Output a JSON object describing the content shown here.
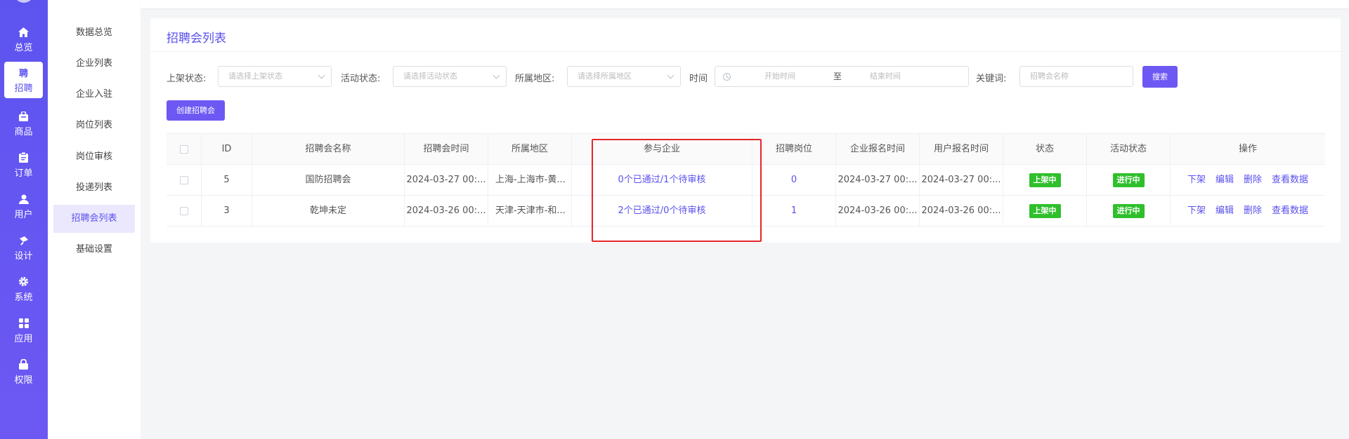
{
  "nav": {
    "items": [
      {
        "label": "总览",
        "icon": "home-icon"
      },
      {
        "label": "招聘",
        "icon": "recruit-icon",
        "badge": "聘",
        "active": true
      },
      {
        "label": "商品",
        "icon": "bag-icon"
      },
      {
        "label": "订单",
        "icon": "clipboard-icon"
      },
      {
        "label": "用户",
        "icon": "user-icon"
      },
      {
        "label": "设计",
        "icon": "brush-icon"
      },
      {
        "label": "系统",
        "icon": "gear-icon"
      },
      {
        "label": "应用",
        "icon": "grid-icon"
      },
      {
        "label": "权限",
        "icon": "lock-icon"
      }
    ]
  },
  "subnav": {
    "items": [
      "数据总览",
      "企业列表",
      "企业入驻",
      "岗位列表",
      "岗位审核",
      "投递列表",
      "招聘会列表",
      "基础设置"
    ],
    "active_index": 6
  },
  "page": {
    "title": "招聘会列表"
  },
  "filters": {
    "listing_status_label": "上架状态:",
    "listing_status_placeholder": "请选择上架状态",
    "activity_status_label": "活动状态:",
    "activity_status_placeholder": "请选择活动状态",
    "region_label": "所属地区:",
    "region_placeholder": "请选择所属地区",
    "time_label": "时间",
    "start_placeholder": "开始时间",
    "range_sep": "至",
    "end_placeholder": "结束时间",
    "keyword_label": "关键词:",
    "keyword_placeholder": "招聘会名称",
    "search_button": "搜索",
    "create_button": "创建招聘会"
  },
  "table": {
    "headers": [
      "ID",
      "招聘会名称",
      "招聘会时间",
      "所属地区",
      "参与企业",
      "招聘岗位",
      "企业报名时间",
      "用户报名时间",
      "状态",
      "活动状态",
      "操作"
    ],
    "actions": [
      "下架",
      "编辑",
      "删除",
      "查看数据"
    ],
    "rows": [
      {
        "id": "5",
        "name": "国防招聘会",
        "time": "2024-03-27 00:...",
        "region": "上海-上海市-黄...",
        "companies": "0个已通过/1个待审核",
        "positions": "0",
        "company_signup": "2024-03-27 00:...",
        "user_signup": "2024-03-27 00:...",
        "status": "上架中",
        "activity": "进行中"
      },
      {
        "id": "3",
        "name": "乾坤未定",
        "time": "2024-03-26 00:...",
        "region": "天津-天津市-和...",
        "companies": "2个已通过/0个待审核",
        "positions": "1",
        "company_signup": "2024-03-26 00:...",
        "user_signup": "2024-03-26 00:...",
        "status": "上架中",
        "activity": "进行中"
      }
    ]
  },
  "colors": {
    "primary": "#6d58f3",
    "status_green": "#2fbf2c",
    "highlight_red": "#e5262a"
  }
}
